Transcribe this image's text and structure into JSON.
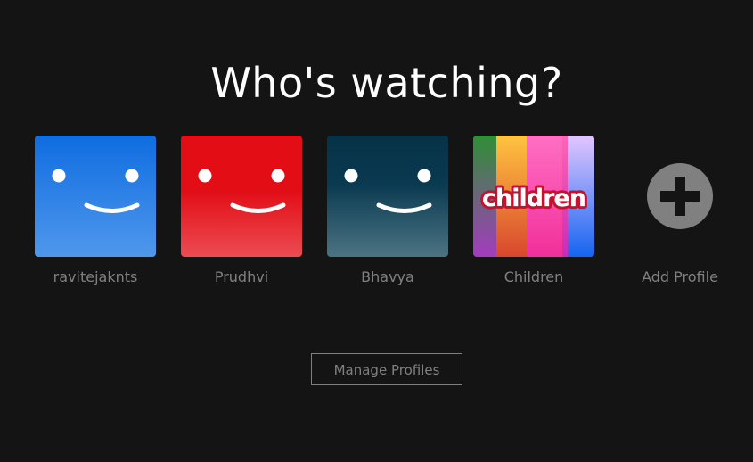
{
  "title": "Who's watching?",
  "profiles": [
    {
      "name": "ravitejaknts",
      "avatar_icon": "smiley-face-icon",
      "color_top": "#0f6de0",
      "color_bottom": "#4f97ec"
    },
    {
      "name": "Prudhvi",
      "avatar_icon": "smiley-face-icon",
      "color_top": "#e20d15",
      "color_bottom": "#ec4b53"
    },
    {
      "name": "Bhavya",
      "avatar_icon": "smiley-face-icon",
      "color_top": "#063247",
      "color_bottom": "#4c7383"
    },
    {
      "name": "Children",
      "avatar_icon": "children-logo-icon",
      "logo_text": "children"
    }
  ],
  "add_profile": {
    "label": "Add Profile",
    "icon": "plus-circle-icon"
  },
  "manage_button": {
    "label": "Manage Profiles"
  },
  "colors": {
    "background": "#141414",
    "muted_text": "#808080",
    "title_text": "#ffffff"
  }
}
